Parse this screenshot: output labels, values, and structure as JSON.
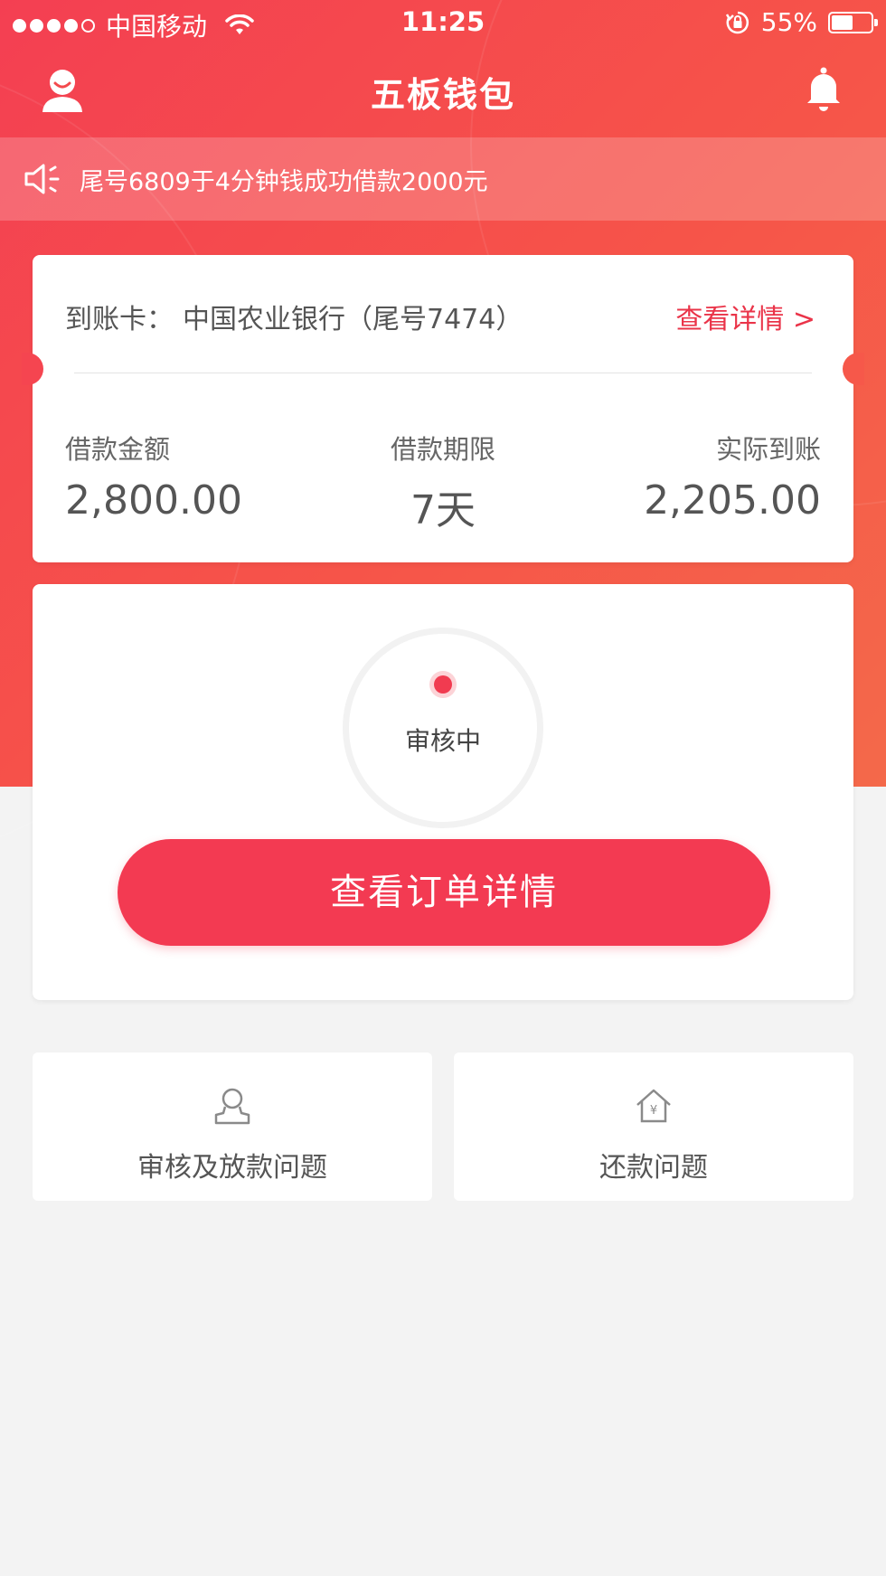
{
  "status_bar": {
    "carrier": "中国移动",
    "time": "11:25",
    "battery": "55%",
    "battery_level": 0.55
  },
  "nav": {
    "title": "五板钱包",
    "left_icon": "user-icon",
    "right_icon": "bell-icon"
  },
  "notice": {
    "icon": "speaker-icon",
    "text": "尾号6809于4分钟钱成功借款2000元"
  },
  "loan_card": {
    "card_label": "到账卡：",
    "bank": "中国农业银行（尾号7474）",
    "detail_link": "查看详情 >",
    "stats": [
      {
        "label": "借款金额",
        "value": "2,800.00"
      },
      {
        "label": "借款期限",
        "value": "7天"
      },
      {
        "label": "实际到账",
        "value": "2,205.00"
      }
    ]
  },
  "status_card": {
    "status": "审核中",
    "button": "查看订单详情"
  },
  "faq": [
    {
      "icon": "user-review-icon",
      "label": "审核及放款问题"
    },
    {
      "icon": "house-yen-icon",
      "label": "还款问题"
    }
  ],
  "colors": {
    "brand_red": "#f33a52",
    "link_red": "#ea3449",
    "background": "#f3f3f3"
  }
}
